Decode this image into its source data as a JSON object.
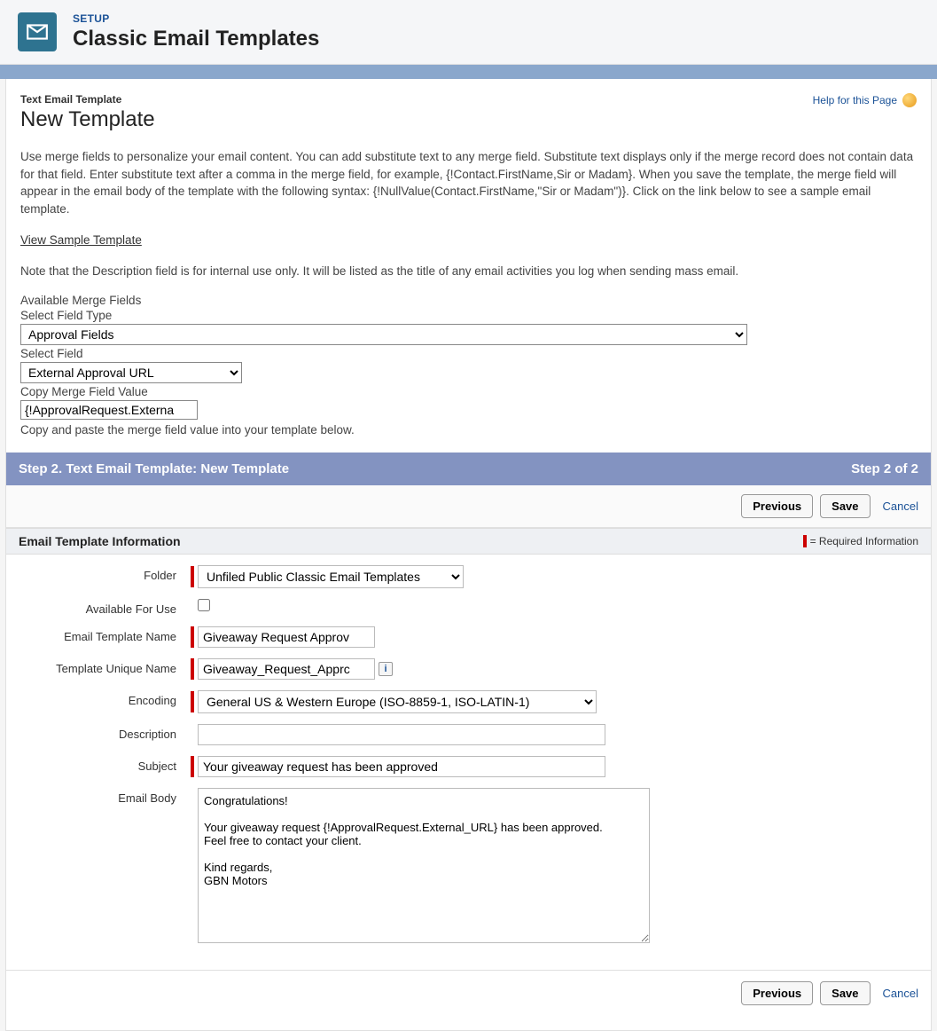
{
  "header": {
    "setup": "SETUP",
    "title": "Classic Email Templates"
  },
  "page": {
    "subtitle": "Text Email Template",
    "title": "New Template",
    "help_label": "Help for this Page",
    "desc": "Use merge fields to personalize your email content. You can add substitute text to any merge field. Substitute text displays only if the merge record does not contain data for that field. Enter substitute text after a comma in the merge field, for example, {!Contact.FirstName,Sir or Madam}. When you save the template, the merge field will appear in the email body of the template with the following syntax: {!NullValue(Contact.FirstName,\"Sir or Madam\")}. Click on the link below to see a sample email template.",
    "view_sample": "View Sample Template",
    "note": "Note that the Description field is for internal use only. It will be listed as the title of any email activities you log when sending mass email."
  },
  "merge": {
    "heading": "Available Merge Fields",
    "field_type_label": "Select Field Type",
    "field_type_value": "Approval Fields",
    "field_label": "Select Field",
    "field_value": "External Approval URL",
    "copy_label": "Copy Merge Field Value",
    "copy_value": "{!ApprovalRequest.Externa",
    "copy_help": "Copy and paste the merge field value into your template below."
  },
  "step": {
    "left": "Step 2. Text Email Template: New Template",
    "right": "Step 2 of 2"
  },
  "buttons": {
    "previous": "Previous",
    "save": "Save",
    "cancel": "Cancel"
  },
  "section": {
    "title": "Email Template Information",
    "required": "= Required Information"
  },
  "form": {
    "labels": {
      "folder": "Folder",
      "available": "Available For Use",
      "name": "Email Template Name",
      "unique": "Template Unique Name",
      "encoding": "Encoding",
      "description": "Description",
      "subject": "Subject",
      "body": "Email Body"
    },
    "values": {
      "folder": "Unfiled Public Classic Email Templates",
      "available_checked": false,
      "name": "Giveaway Request Approv",
      "unique": "Giveaway_Request_Apprc",
      "encoding": "General US & Western Europe (ISO-8859-1, ISO-LATIN-1)",
      "description": "",
      "subject": "Your giveaway request has been approved",
      "body": "Congratulations!\n\nYour giveaway request {!ApprovalRequest.External_URL} has been approved.\nFeel free to contact your client.\n\nKind regards,\nGBN Motors"
    }
  }
}
